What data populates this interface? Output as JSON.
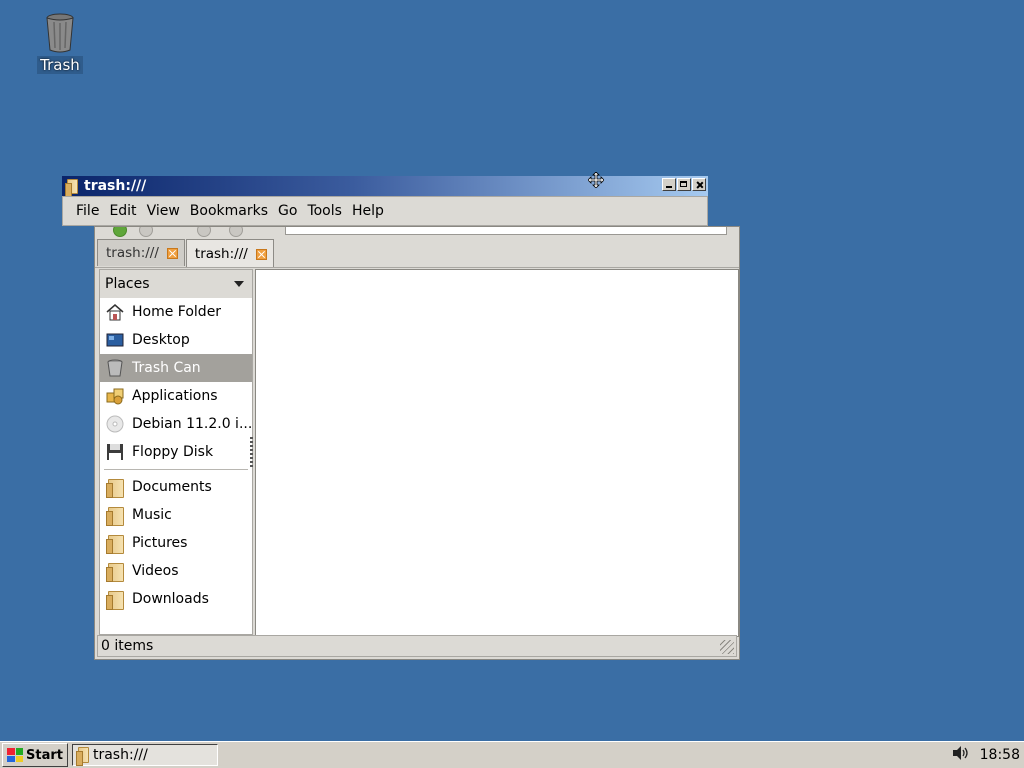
{
  "desktop": {
    "trash_label": "Trash"
  },
  "window": {
    "title": "trash:///",
    "menu": [
      "File",
      "Edit",
      "View",
      "Bookmarks",
      "Go",
      "Tools",
      "Help"
    ],
    "tabs": [
      {
        "label": "trash:///"
      },
      {
        "label": "trash:///"
      }
    ],
    "sidebar": {
      "header": "Places",
      "places": [
        {
          "label": "Home Folder",
          "icon": "home-icon"
        },
        {
          "label": "Desktop",
          "icon": "desktop-icon"
        },
        {
          "label": "Trash Can",
          "icon": "trash-icon",
          "selected": true
        },
        {
          "label": "Applications",
          "icon": "applications-icon"
        },
        {
          "label": "Debian 11.2.0 i...",
          "icon": "cdrom-icon"
        },
        {
          "label": "Floppy Disk",
          "icon": "floppy-icon"
        }
      ],
      "bookmarks": [
        {
          "label": "Documents",
          "icon": "folder-icon"
        },
        {
          "label": "Music",
          "icon": "folder-icon"
        },
        {
          "label": "Pictures",
          "icon": "folder-icon"
        },
        {
          "label": "Videos",
          "icon": "folder-icon"
        },
        {
          "label": "Downloads",
          "icon": "folder-icon"
        }
      ]
    },
    "status": "0 items"
  },
  "taskbar": {
    "start_label": "Start",
    "task_label": "trash:///",
    "clock": "18:58"
  },
  "colors": {
    "desktop_bg": "#3a6ea5",
    "selection": "#a3a19c",
    "title_gradient_start": "#0a246a",
    "title_gradient_end": "#a6caf0"
  }
}
